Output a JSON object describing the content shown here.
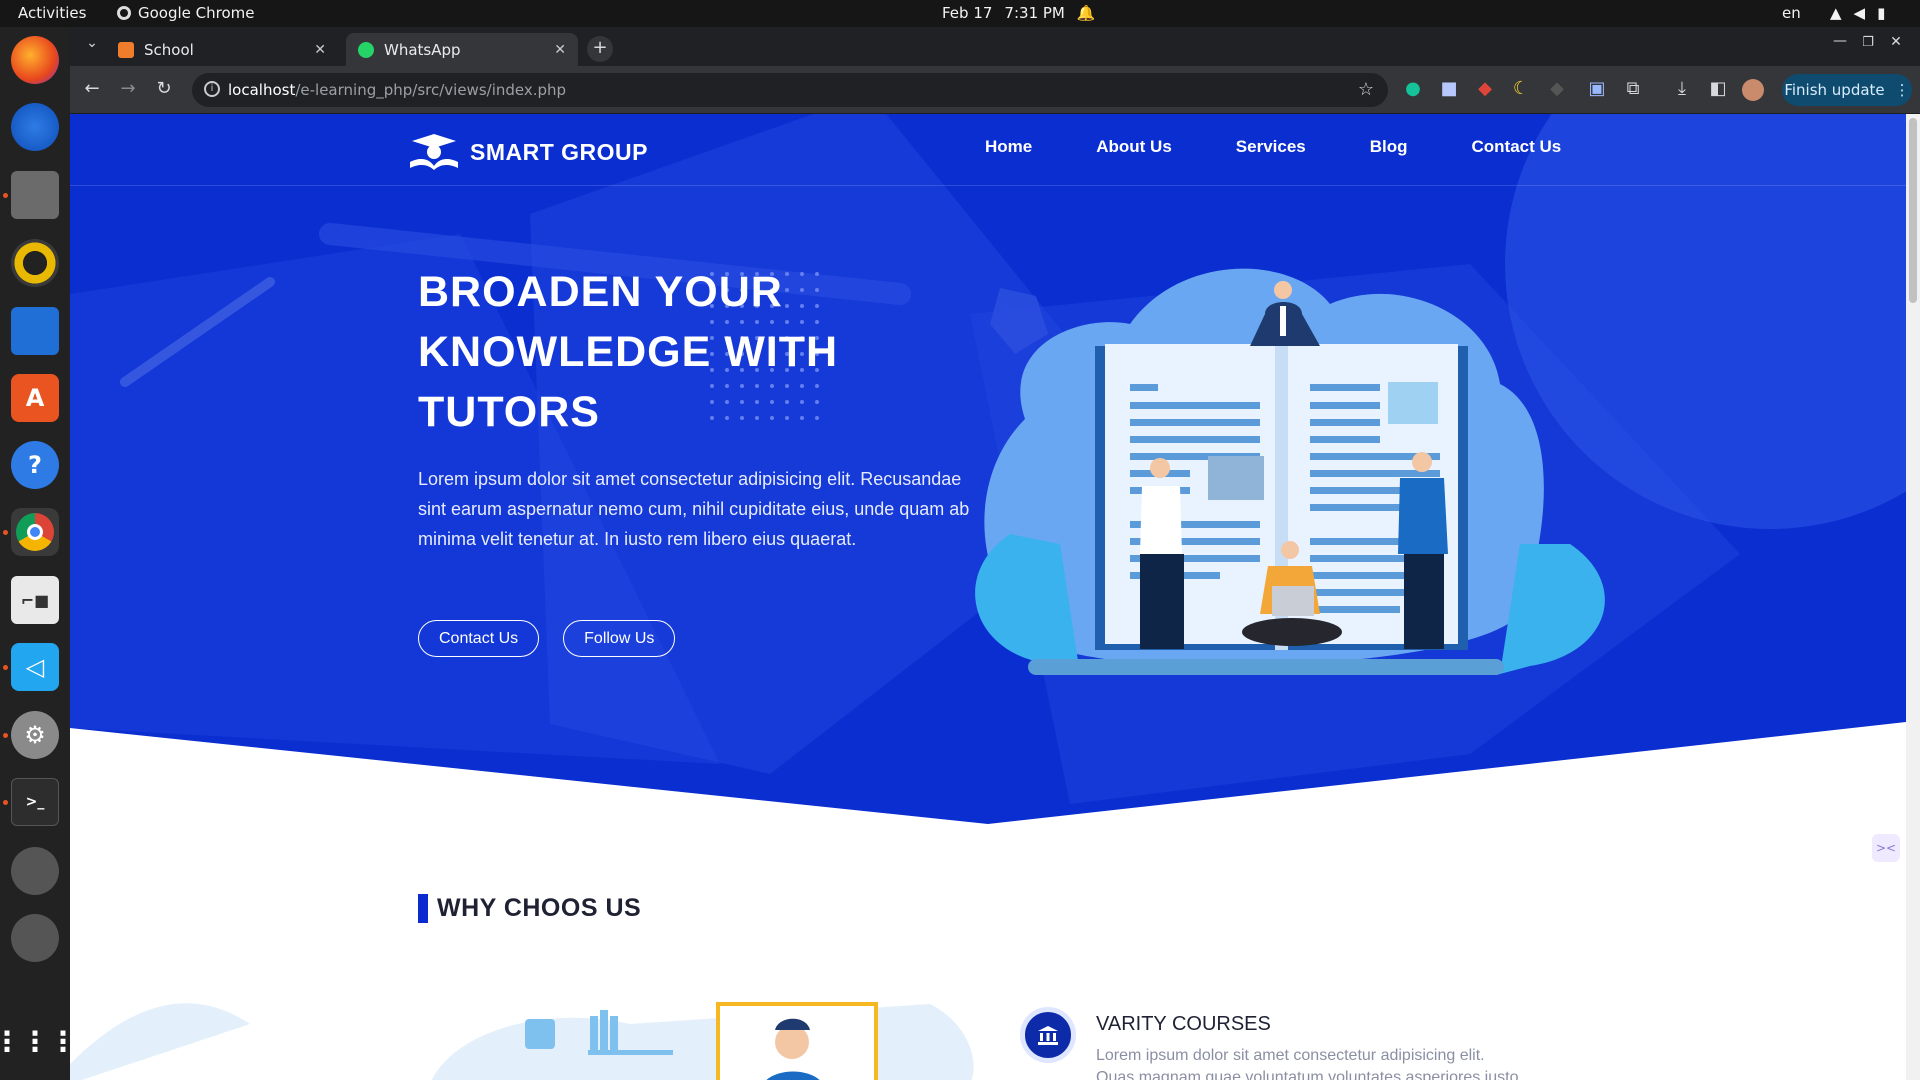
{
  "system": {
    "activities": "Activities",
    "app_name": "Google Chrome",
    "date": "Feb 17",
    "time": "7:31 PM",
    "language": "en"
  },
  "browser": {
    "tabs": [
      {
        "label": "School",
        "icon": "xampp-icon"
      },
      {
        "label": "WhatsApp",
        "icon": "whatsapp-icon"
      }
    ],
    "url_host": "localhost",
    "url_path": "/e-learning_php/src/views/index.php",
    "finish_update": "Finish update"
  },
  "site": {
    "logo_text": "SMART GROUP",
    "nav": [
      "Home",
      "About Us",
      "Services",
      "Blog",
      "Contact Us"
    ],
    "hero": {
      "title_line1": "BROADEN YOUR",
      "title_line2": "KNOWLEDGE WITH",
      "title_line3": "TUTORS",
      "text": "Lorem ipsum dolor sit amet consectetur adipisicing elit. Recusandae sint earum aspernatur nemo cum, nihil cupiditate eius, unde quam ab minima velit tenetur at. In iusto rem libero eius quaerat.",
      "btn_contact": "Contact Us",
      "btn_follow": "Follow Us"
    },
    "why": {
      "title": "WHY CHOOS US",
      "feature_title": "VARITY COURSES",
      "feature_text_1": "Lorem ipsum dolor sit amet consectetur adipisicing elit.",
      "feature_text_2": "Quas magnam quae voluntatum voluntates asperiores iusto"
    }
  },
  "colors": {
    "hero_blue": "#0b2ed0",
    "accent": "#0b2bd1",
    "text_dark": "#1f2233"
  }
}
